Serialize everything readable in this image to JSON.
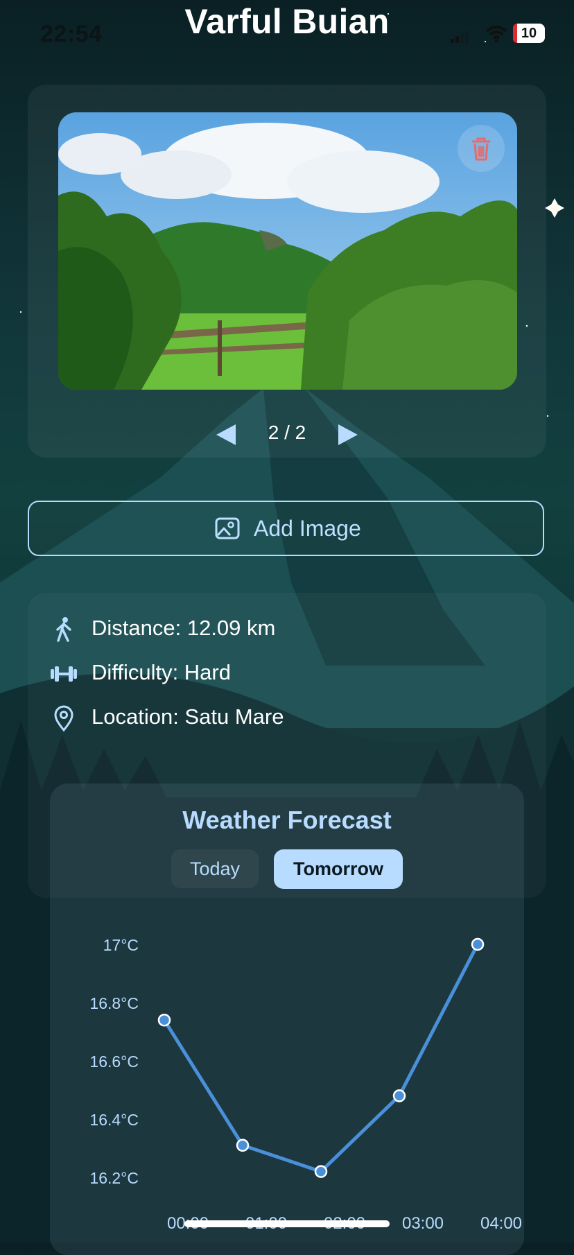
{
  "status": {
    "time": "22:54",
    "battery": "10"
  },
  "header": {
    "title": "Varful Buian"
  },
  "gallery": {
    "page": "2 / 2"
  },
  "actions": {
    "add_image": "Add Image"
  },
  "info": {
    "distance": "Distance: 12.09 km",
    "difficulty": "Difficulty: Hard",
    "location": "Location: Satu Mare"
  },
  "weather": {
    "title": "Weather Forecast",
    "tabs": {
      "today": "Today",
      "tomorrow": "Tomorrow"
    },
    "selected_tab": "Tomorrow"
  },
  "colors": {
    "accent": "#b8dcff",
    "line": "#4a90d9",
    "danger": "#e86a6a"
  },
  "chart_data": {
    "type": "line",
    "x": [
      "00:00",
      "01:00",
      "02:00",
      "03:00",
      "04:00"
    ],
    "series": [
      {
        "values": [
          16.74,
          16.31,
          16.22,
          16.48,
          17.0
        ]
      }
    ],
    "yticks": [
      "17°C",
      "16.8°C",
      "16.6°C",
      "16.4°C",
      "16.2°C"
    ],
    "ylim": [
      16.2,
      17.0
    ],
    "grid": false
  }
}
